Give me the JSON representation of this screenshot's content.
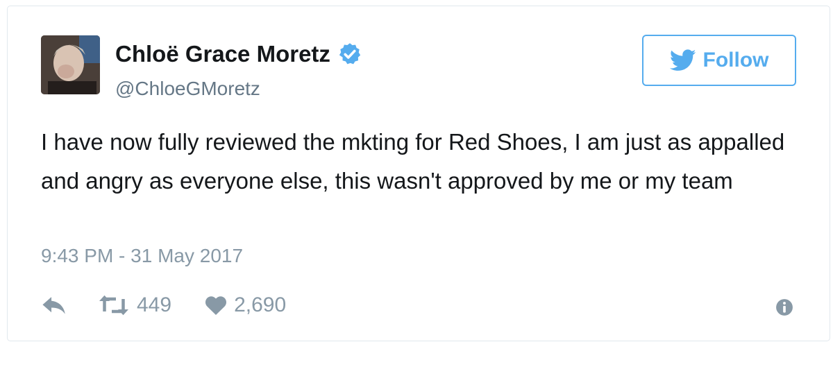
{
  "tweet": {
    "author_name": "Chloë Grace Moretz",
    "handle": "@ChloeGMoretz",
    "text": "I have now fully reviewed the mkting for Red Shoes, I am just as appalled and angry as everyone else, this wasn't approved by me or my team",
    "timestamp": "9:43 PM - 31 May 2017",
    "follow_label": "Follow",
    "retweet_count": "449",
    "like_count": "2,690"
  },
  "icons": {
    "verified": "verified-badge-icon",
    "follow": "twitter-bird-icon",
    "reply": "reply-icon",
    "retweet": "retweet-icon",
    "like": "heart-icon",
    "info": "info-icon"
  },
  "colors": {
    "twitter_blue": "#55acee",
    "text_primary": "#14171a",
    "text_secondary": "#657786",
    "meta_gray": "#8899a6",
    "border": "#e1e8ed"
  }
}
